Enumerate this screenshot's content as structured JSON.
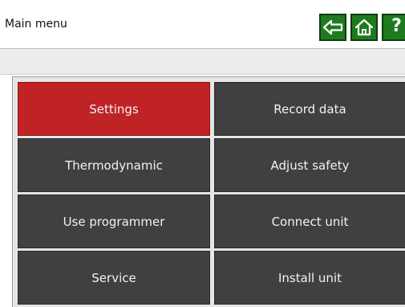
{
  "header": {
    "title": "Main menu",
    "back_icon": "left-arrow-icon",
    "home_icon": "home-icon",
    "help_label": "?"
  },
  "colors": {
    "nav_button": "#1f7a1f",
    "menu_button": "#404040",
    "menu_button_active": "#bf2326"
  },
  "menu": {
    "items": [
      {
        "label": "Settings",
        "active": true
      },
      {
        "label": "Record data",
        "active": false
      },
      {
        "label": "Thermodynamic",
        "active": false
      },
      {
        "label": "Adjust safety",
        "active": false
      },
      {
        "label": "Use programmer",
        "active": false
      },
      {
        "label": "Connect unit",
        "active": false
      },
      {
        "label": "Service",
        "active": false
      },
      {
        "label": "Install unit",
        "active": false
      }
    ]
  }
}
